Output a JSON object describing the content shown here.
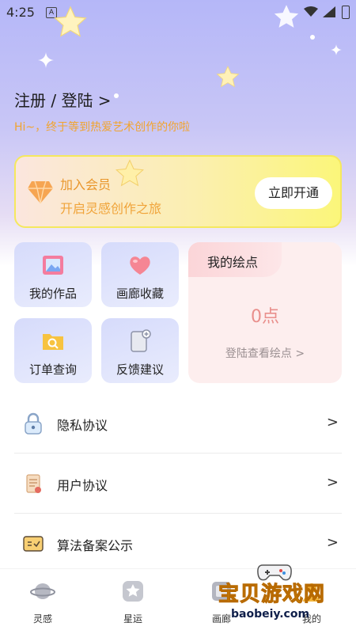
{
  "status_bar": {
    "time": "4:25",
    "sim_label": "A"
  },
  "header": {
    "login_text": "注册 / 登陆 >",
    "tagline": "Hi~，终于等到热爱艺术创作的你啦"
  },
  "vip": {
    "title": "加入会员",
    "subtitle": "开启灵感创作之旅",
    "button": "立即开通"
  },
  "tiles": [
    {
      "label": "我的作品",
      "icon": "picture-frame-icon"
    },
    {
      "label": "画廊收藏",
      "icon": "heart-icon"
    },
    {
      "label": "订单查询",
      "icon": "search-folder-icon"
    },
    {
      "label": "反馈建议",
      "icon": "feedback-doc-icon"
    }
  ],
  "points": {
    "title": "我的绘点",
    "value": "0点",
    "link": "登陆查看绘点 >"
  },
  "menu": [
    {
      "label": "隐私协议",
      "icon": "lock-icon",
      "arrow": ">"
    },
    {
      "label": "用户协议",
      "icon": "scroll-icon",
      "arrow": ">"
    },
    {
      "label": "算法备案公示",
      "icon": "certificate-icon",
      "arrow": ">"
    }
  ],
  "tabs": [
    {
      "label": "灵感",
      "icon": "planet-icon"
    },
    {
      "label": "星运",
      "icon": "star-badge-icon"
    },
    {
      "label": "画廊",
      "icon": "gallery-icon"
    },
    {
      "label": "我的",
      "icon": "profile-icon"
    }
  ],
  "watermark": {
    "title": "宝贝游戏网",
    "url": "baobeiy.com"
  },
  "colors": {
    "accent_orange": "#f1a42f",
    "points_value": "#e98f8c",
    "bg_top": "#b5b7f8"
  }
}
